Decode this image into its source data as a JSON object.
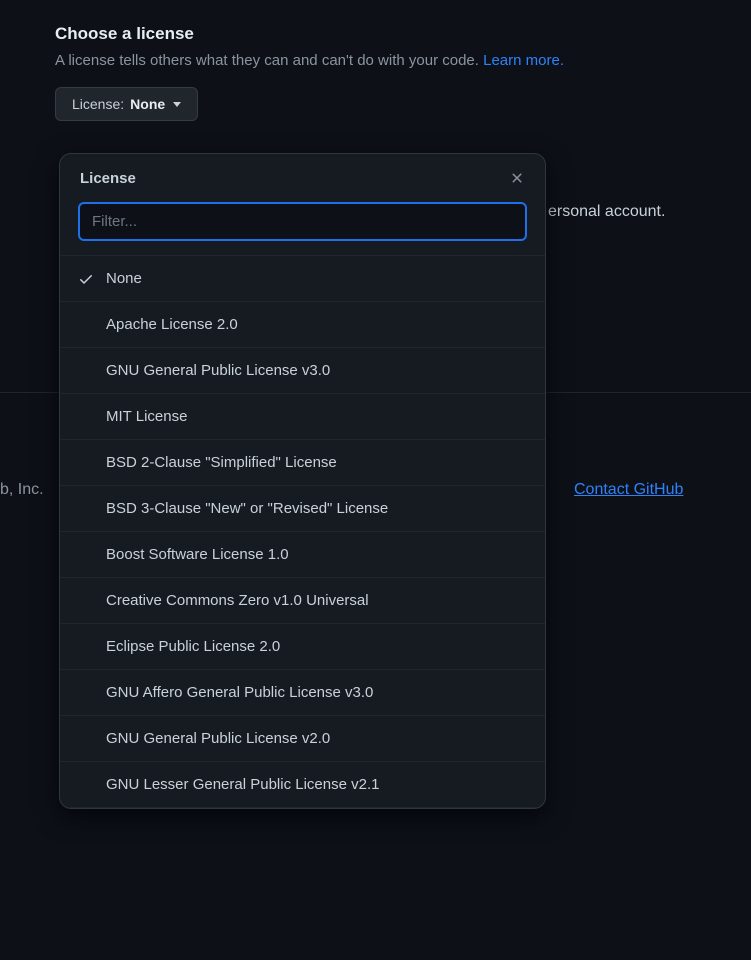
{
  "header": {
    "title": "Choose a license",
    "description": "A license tells others what they can and can't do with your code. ",
    "learn_more": "Learn more."
  },
  "button": {
    "label": "License:",
    "value": "None"
  },
  "dropdown": {
    "title": "License",
    "filter_placeholder": "Filter...",
    "selected_index": 0,
    "options": [
      "None",
      "Apache License 2.0",
      "GNU General Public License v3.0",
      "MIT License",
      "BSD 2-Clause \"Simplified\" License",
      "BSD 3-Clause \"New\" or \"Revised\" License",
      "Boost Software License 1.0",
      "Creative Commons Zero v1.0 Universal",
      "Eclipse Public License 2.0",
      "GNU Affero General Public License v3.0",
      "GNU General Public License v2.0",
      "GNU Lesser General Public License v2.1"
    ]
  },
  "background": {
    "account_text": "ersonal account.",
    "inc_text": "b, Inc.",
    "contact_link": "Contact GitHub"
  }
}
